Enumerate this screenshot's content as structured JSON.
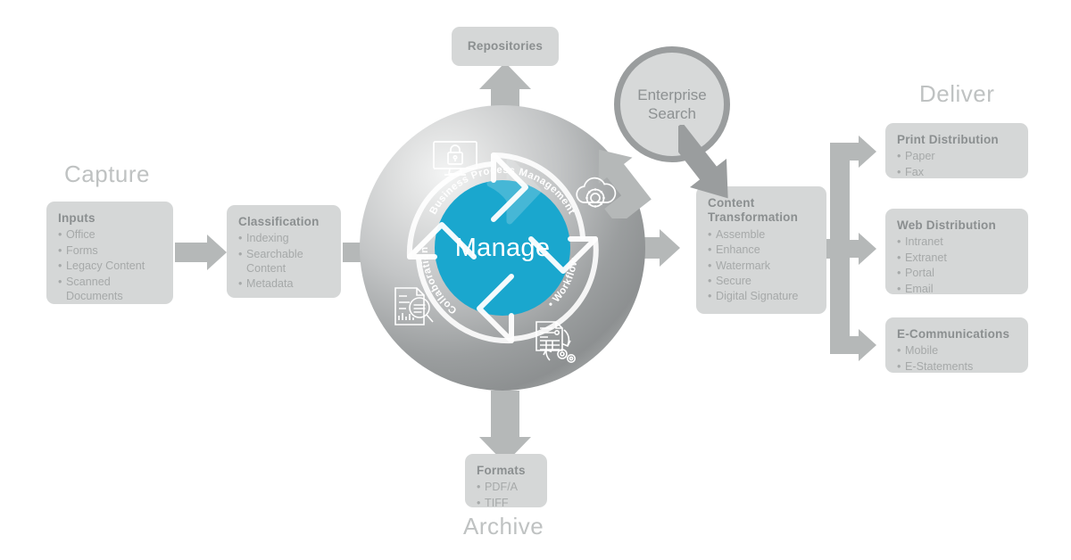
{
  "sections": {
    "capture": "Capture",
    "deliver": "Deliver",
    "archive": "Archive"
  },
  "panels": {
    "inputs": {
      "title": "Inputs",
      "items": [
        "Office",
        "Forms",
        "Legacy Content",
        "Scanned Documents"
      ]
    },
    "classification": {
      "title": "Classification",
      "items": [
        "Indexing",
        "Searchable Content",
        "Metadata"
      ]
    },
    "repositories": {
      "title": "Repositories"
    },
    "content_transformation": {
      "title": "Content Transformation",
      "items": [
        "Assemble",
        "Enhance",
        "Watermark",
        "Secure",
        "Digital Signature"
      ]
    },
    "formats": {
      "title": "Formats",
      "items": [
        "PDF/A",
        "TIFF"
      ]
    },
    "print_distribution": {
      "title": "Print Distribution",
      "items": [
        "Paper",
        "Fax"
      ]
    },
    "web_distribution": {
      "title": "Web Distribution",
      "items": [
        "Intranet",
        "Extranet",
        "Portal",
        "Email"
      ]
    },
    "e_communications": {
      "title": "E-Communications",
      "items": [
        "Mobile",
        "E-Statements"
      ]
    }
  },
  "enterprise_search": {
    "line1": "Enterprise",
    "line2": "Search"
  },
  "core": {
    "label": "Manage",
    "arc_top": "Business Process Management",
    "arc_right": "• Workflow",
    "arc_left": "Collaboration"
  },
  "icons": {
    "monitor_lock": "monitor-lock-icon",
    "cloud_gear": "cloud-gear-icon",
    "document_search": "document-search-icon",
    "workflow_gears": "workflow-gears-icon"
  },
  "colors": {
    "accent_teal": "#1AA7CE",
    "panel_bg": "#D5D7D7",
    "arrow_grey": "#B5B8B8",
    "heading_grey": "#8B8F90",
    "body_grey": "#A6A9A9",
    "section_grey": "#BFC2C2"
  }
}
